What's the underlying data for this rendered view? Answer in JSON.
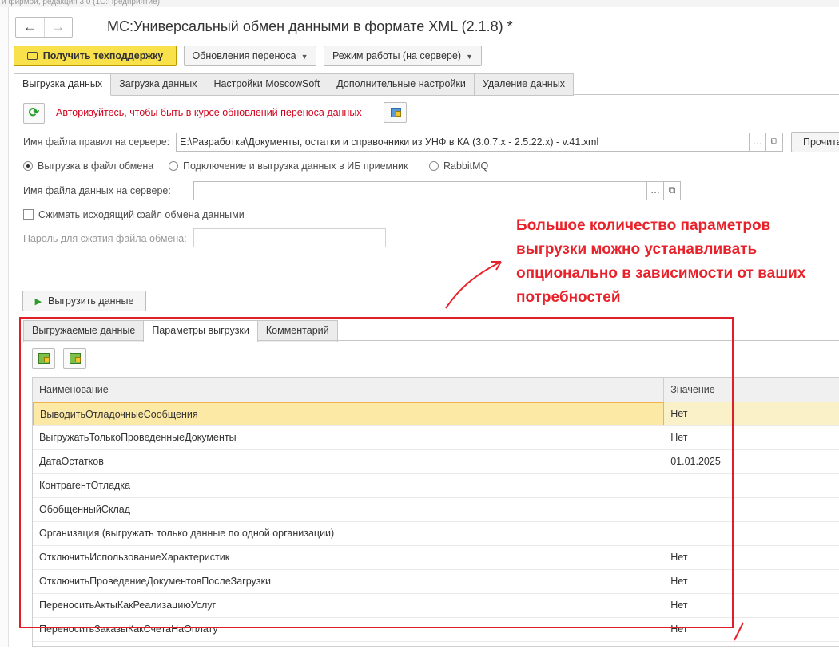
{
  "topbar_text": "и фирмой, редакция 3.0 (1С:Предприятие)",
  "window": {
    "title": "МС:Универсальный обмен данными в формате XML (2.1.8) *"
  },
  "nav": {
    "back": "←",
    "forward": "→"
  },
  "toolbar": {
    "support": "Получить техподдержку",
    "updates": "Обновления переноса",
    "mode": "Режим работы (на сервере)"
  },
  "main_tabs": [
    "Выгрузка данных",
    "Загрузка данных",
    "Настройки MoscowSoft",
    "Дополнительные настройки",
    "Удаление данных"
  ],
  "auth_link": "Авторизуйтесь, чтобы быть в курсе обновлений переноса данных",
  "rules_file": {
    "label": "Имя файла правил на сервере:",
    "value": "E:\\Разработка\\Документы, остатки и справочники из УНФ в КА (3.0.7.x - 2.5.22.x) - v.41.xml",
    "read_button": "Прочитать"
  },
  "export_modes": [
    "Выгрузка в файл обмена",
    "Подключение и выгрузка данных в ИБ приемник",
    "RabbitMQ"
  ],
  "data_file": {
    "label": "Имя файла данных на сервере:",
    "value": ""
  },
  "compress": {
    "label": "Сжимать исходящий файл обмена данными"
  },
  "password": {
    "label": "Пароль для сжатия файла обмена:",
    "value": ""
  },
  "export_button": "Выгрузить данные",
  "annotation": "Большое количество параметров выгрузки можно устанавливать опционально в зависимости от ваших потребностей",
  "sub_tabs": [
    "Выгружаемые данные",
    "Параметры выгрузки",
    "Комментарий"
  ],
  "grid": {
    "headers": [
      "Наименование",
      "Значение"
    ],
    "rows": [
      {
        "name": "ВыводитьОтладочныеСообщения",
        "value": "Нет"
      },
      {
        "name": "ВыгружатьТолькоПроведенныеДокументы",
        "value": "Нет"
      },
      {
        "name": "ДатаОстатков",
        "value": "01.01.2025"
      },
      {
        "name": "КонтрагентОтладка",
        "value": ""
      },
      {
        "name": "ОбобщенныйСклад",
        "value": ""
      },
      {
        "name": "Организация (выгружать только данные по одной организации)",
        "value": ""
      },
      {
        "name": "ОтключитьИспользованиеХарактеристик",
        "value": "Нет"
      },
      {
        "name": "ОтключитьПроведениеДокументовПослеЗагрузки",
        "value": "Нет"
      },
      {
        "name": "ПереноситьАктыКакРеализациюУслуг",
        "value": "Нет"
      },
      {
        "name": "ПереноситьЗаказыКакСчетаНаОплату",
        "value": "Нет"
      }
    ]
  },
  "colors": {
    "accent_yellow": "#f9e14b",
    "annotation_red": "#e8222a",
    "link_red": "#d0021b",
    "selection": "#fde9a6"
  }
}
